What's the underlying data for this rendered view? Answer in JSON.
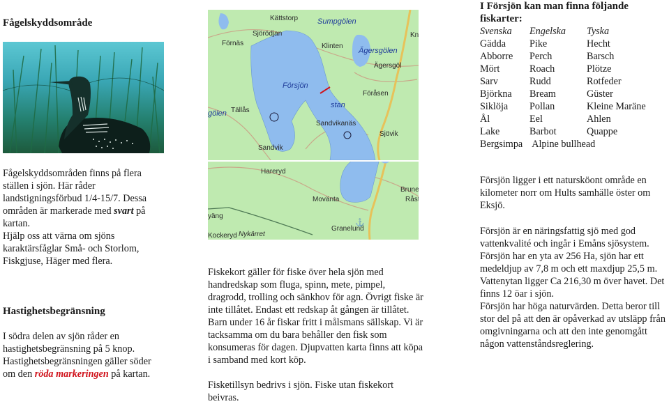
{
  "left": {
    "title": "Fågelskyddsområde",
    "photo_alt": "Storlom (Black-throated loon) in grass",
    "paragraph_parts": [
      "Fågelskyddsområden finns på flera ställen i sjön. Här råder landstigningsförbud 1/4-15/7. Dessa områden är markerade med ",
      "svart",
      " på kartan.",
      "Hjälp oss att värna om sjöns karaktärsfåglar Små- och Storlom, Fiskgjuse, Häger med flera."
    ],
    "speed": {
      "title": "Hastighetsbegränsning",
      "parts": [
        "I södra delen av sjön råder en hastighetsbegränsning på 5 knop. Hastighetsbegränsningen gäller söder om den ",
        "röda markeringen",
        " på kartan."
      ],
      "accent_color": "#d0121b"
    }
  },
  "map": {
    "top_labels": [
      "Kättstorp",
      "Sumpgölen",
      "Sjörödjan",
      "Förnäs",
      "Klinten",
      "Ägersgölen",
      "Ägersgöl",
      "Försjön",
      "Föråsen",
      "Tällås",
      "stan",
      "Sandvikanäs",
      "Sjövik",
      "Sandvik",
      "gölen",
      "Kn"
    ],
    "bottom_labels": [
      "Hareryd",
      "Movänta",
      "Brunet",
      "Råst",
      "yäng",
      "Granelund",
      "Kockeryd",
      "Nykärret"
    ],
    "colors": {
      "land": "#bfeab0",
      "water": "#8fbcee",
      "road": "#e7c25a",
      "speed_marker": "#d0121b"
    }
  },
  "center": {
    "paragraph1": "Fiskekort gäller för fiske över hela sjön med handredskap som fluga, spinn, mete, pimpel, dragrodd, trolling och sänkhov för agn. Övrigt fiske är inte tillåtet. Endast ett redskap åt gången är tillåtet. Barn under 16 år fiskar fritt i målsmans sällskap. Vi är tacksamma om du bara behåller den fisk som konsumeras för dagen. Djupvatten karta finns att köpa i samband med kort köp.",
    "paragraph2": "Fisketillsyn bedrivs i sjön. Fiske utan fiskekort beivras."
  },
  "fish": {
    "title": "I Försjön kan man finna följande fiskarter:",
    "headers": [
      "Svenska",
      "Engelska",
      "Tyska"
    ],
    "rows": [
      [
        "Gädda",
        "Pike",
        "Hecht"
      ],
      [
        "Abborre",
        "Perch",
        "Barsch"
      ],
      [
        "Mört",
        "Roach",
        "Plötze"
      ],
      [
        "Sarv",
        "Rudd",
        "Rotfeder"
      ],
      [
        "Björkna",
        "Bream",
        "Güster"
      ],
      [
        "Siklöja",
        "Pollan",
        "Kleine Maräne"
      ],
      [
        "Ål",
        "Eel",
        "Ahlen"
      ],
      [
        "Lake",
        "Barbot",
        "Quappe"
      ]
    ],
    "last_row": [
      "Bergsimpa",
      "Alpine bullhead"
    ]
  },
  "right": {
    "paragraph1": "Försjön ligger i ett natursköont område en kilometer norr om Hults samhälle öster om Eksjö.",
    "paragraph2": "Försjön är en näringsfattig sjö med god vattenkvalité och ingår i Emåns sjösystem. Försjön har en yta av 256 Ha, sjön har ett medeldjup av 7,8 m och ett maxdjup 25,5 m. Vattenytan ligger Ca 216,30 m över havet. Det finns 12 öar i sjön.",
    "paragraph3": "Försjön har höga naturvärden. Detta beror till stor del på att den är opåverkad av utsläpp från omgivningarna och att den inte genomgått någon vattenståndsreglering."
  }
}
